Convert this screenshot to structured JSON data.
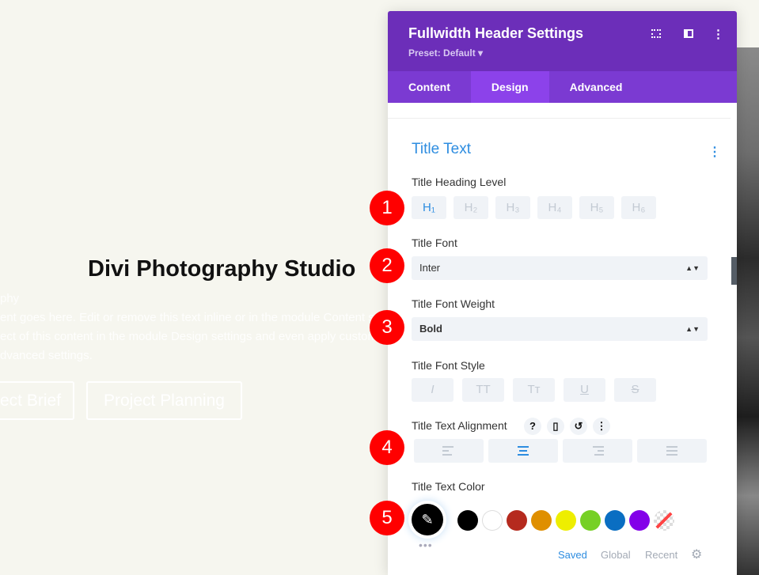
{
  "page": {
    "title": "Divi Photography Studio",
    "lines": [
      "phy",
      "ent goes here. Edit or remove this text inline or in the module Content se",
      "ect of this content in the module Design settings and even apply custom",
      "dvanced settings."
    ],
    "buttons": [
      "ect Brief",
      "Project Planning"
    ]
  },
  "panel": {
    "title": "Fullwidth Header Settings",
    "preset": "Preset: Default ▾",
    "icons": [
      "fullscreen-icon",
      "split-view-icon",
      "more-icon"
    ],
    "tabs": [
      "Content",
      "Design",
      "Advanced"
    ],
    "active_tab": "Design",
    "section": "Title Text",
    "heading_label": "Title Heading Level",
    "heading_levels": [
      "H₁",
      "H₂",
      "H₃",
      "H₄",
      "H₅",
      "H₆"
    ],
    "heading_selected": "H1",
    "font_label": "Title Font",
    "font_value": "Inter",
    "weight_label": "Title Font Weight",
    "weight_value": "Bold",
    "style_label": "Title Font Style",
    "styles": [
      "I",
      "TT",
      "Tт",
      "U",
      "S"
    ],
    "align_label": "Title Text Alignment",
    "align_selected": "center",
    "color_label": "Title Text Color",
    "color_value": "#000000",
    "swatches": [
      "#000000",
      "#ffffff",
      "#b52a1e",
      "#df8f00",
      "#eeee00",
      "#76d025",
      "#0a6ec2",
      "#8300e9",
      "transparent"
    ],
    "color_tabs": [
      "Saved",
      "Global",
      "Recent"
    ],
    "color_tab_active": "Saved"
  },
  "badges": [
    "1",
    "2",
    "3",
    "4",
    "5"
  ],
  "colors": {
    "header": "#6c2eb9",
    "accent": "#2e8de0",
    "badge": "#ff0000"
  }
}
